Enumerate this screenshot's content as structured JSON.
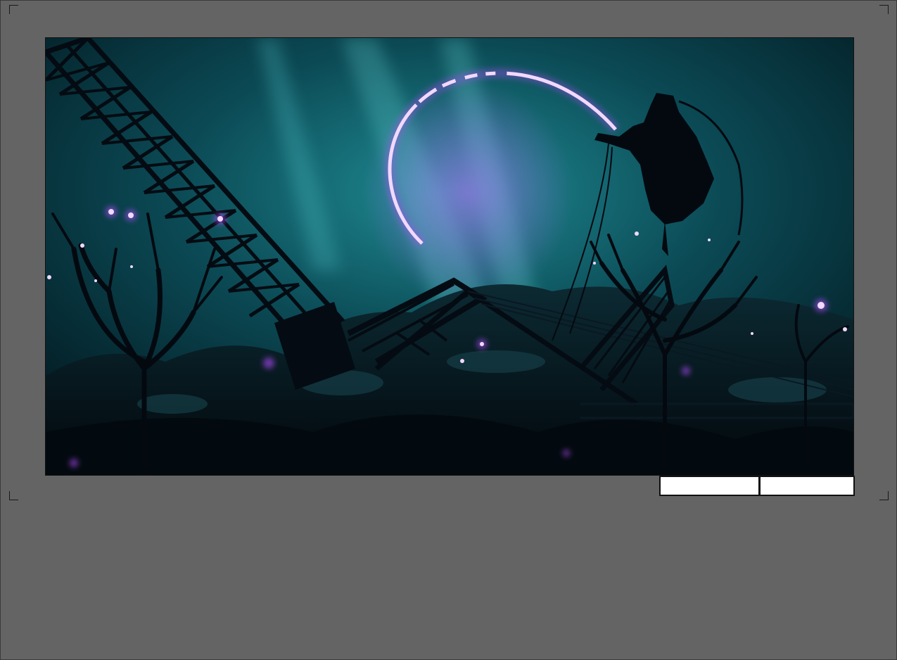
{
  "storyboard": {
    "panel": {
      "scene": "underwater-wreck-scene",
      "colors": {
        "water_light": "#1f8c94",
        "water_mid": "#0b4a55",
        "water_dark": "#02141b",
        "glow": "#f3d8ff",
        "glow_purple": "#b34cff",
        "silhouette": "#040910"
      }
    },
    "boxes": {
      "shot_label": "",
      "time_label": ""
    }
  }
}
